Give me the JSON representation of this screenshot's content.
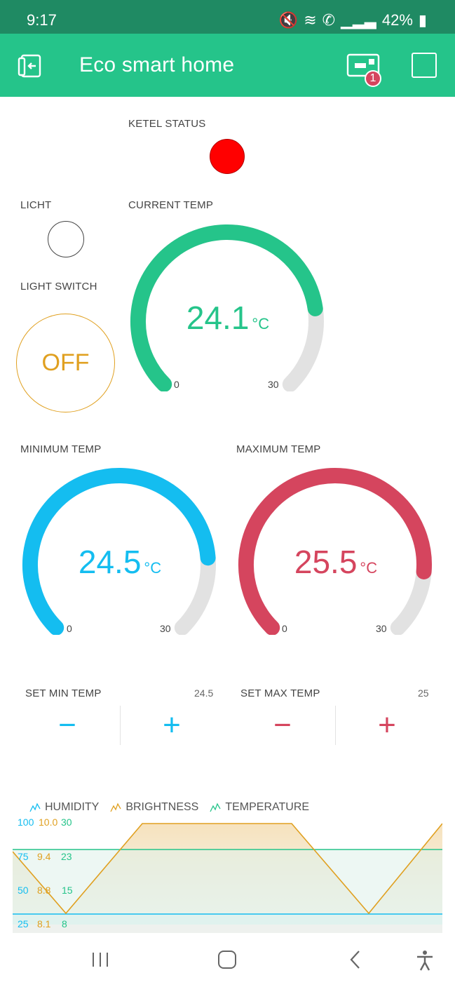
{
  "status_bar": {
    "time": "9:17",
    "battery": "42%"
  },
  "app": {
    "title": "Eco smart home",
    "notification_count": "1"
  },
  "ketel": {
    "label": "KETEL STATUS",
    "led_color": "#ff0000"
  },
  "licht": {
    "label": "LICHT"
  },
  "light_switch": {
    "label": "LIGHT SWITCH",
    "state": "OFF",
    "color": "#e0a020"
  },
  "current_temp": {
    "label": "CURRENT TEMP",
    "value": "24.1",
    "unit": "°C",
    "min": "0",
    "max": "30",
    "color": "#25c48a",
    "level": 0.803
  },
  "minimum_temp": {
    "label": "MINIMUM TEMP",
    "value": "24.5",
    "unit": "°C",
    "min": "0",
    "max": "30",
    "color": "#14bdf0",
    "level": 0.817
  },
  "maximum_temp": {
    "label": "MAXIMUM TEMP",
    "value": "25.5",
    "unit": "°C",
    "min": "0",
    "max": "30",
    "color": "#d5455e",
    "level": 0.85
  },
  "set_min": {
    "label": "SET MIN TEMP",
    "value": "24.5",
    "minus": "−",
    "plus": "+",
    "color": "#14bdf0"
  },
  "set_max": {
    "label": "SET MAX TEMP",
    "value": "25",
    "minus": "−",
    "plus": "+",
    "color": "#d5455e"
  },
  "chart_data": {
    "type": "line",
    "series": [
      {
        "name": "HUMIDITY",
        "color": "#14bdf0",
        "axis_ticks": [
          "100",
          "75",
          "50",
          "25"
        ]
      },
      {
        "name": "BRIGHTNESS",
        "color": "#e0a020",
        "axis_ticks": [
          "10.0",
          "9.4",
          "8.8",
          "8.1"
        ]
      },
      {
        "name": "TEMPERATURE",
        "color": "#25c48a",
        "axis_ticks": [
          "30",
          "23",
          "15",
          "8"
        ]
      }
    ]
  }
}
